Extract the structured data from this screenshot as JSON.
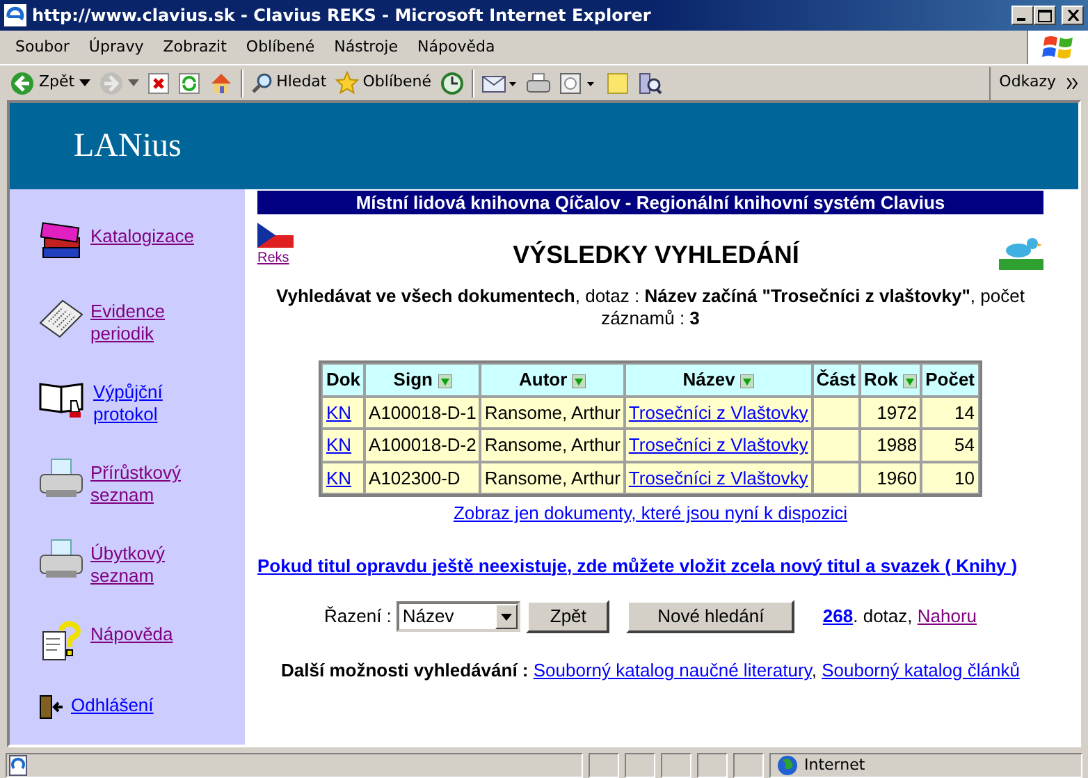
{
  "window": {
    "title": "http://www.clavius.sk - Clavius REKS - Microsoft Internet Explorer"
  },
  "menu": [
    "Soubor",
    "Úpravy",
    "Zobrazit",
    "Oblíbené",
    "Nástroje",
    "Nápověda"
  ],
  "toolbar": [
    {
      "kind": "back",
      "label": "Zpět",
      "disabled": false
    },
    {
      "kind": "forward",
      "disabled": true
    },
    {
      "kind": "stop"
    },
    {
      "kind": "refresh"
    },
    {
      "kind": "home"
    },
    {
      "kind": "search",
      "label": "Hledat"
    },
    {
      "kind": "favorites",
      "label": "Oblíbené"
    },
    {
      "kind": "history"
    },
    {
      "kind": "mail"
    },
    {
      "kind": "print"
    },
    {
      "kind": "edit"
    },
    {
      "kind": "note"
    },
    {
      "kind": "messenger"
    }
  ],
  "links_label": "Odkazy",
  "header": {
    "logo": "LANius"
  },
  "sidebar": {
    "items": [
      {
        "kind": "books",
        "label": "Katalogizace",
        "visited": true
      },
      {
        "kind": "newspaper",
        "label": "Evidence periodik",
        "visited": true
      },
      {
        "kind": "book",
        "label": "Výpůjční protokol",
        "visited": false
      },
      {
        "kind": "printer",
        "label": "Přírůstkový seznam",
        "visited": true
      },
      {
        "kind": "printer",
        "label": "Úbytkový seznam",
        "visited": true
      },
      {
        "kind": "help",
        "label": "Nápověda",
        "visited": true
      },
      {
        "kind": "logout",
        "label": "Odhlášení",
        "visited": false
      }
    ]
  },
  "banner": "Místní lidová knihovna Qíčalov - Regionální knihovní systém Clavius",
  "flag_link": {
    "label": "Reks",
    "visited": true
  },
  "heading": "VÝSLEDKY VYHLEDÁNÍ",
  "query": "**Vyhledávat ve všech dokumentech**, dotaz : **Název začíná \"Trosečníci z vlaštovky\"**, počet záznamů : **3**",
  "table": {
    "columns": [
      {
        "label": "Dok",
        "sortable": false
      },
      {
        "label": "Sign",
        "sortable": true
      },
      {
        "label": "Autor",
        "sortable": true
      },
      {
        "label": "Název",
        "sortable": true
      },
      {
        "label": "Část",
        "sortable": false
      },
      {
        "label": "Rok",
        "sortable": true
      },
      {
        "label": "Počet",
        "sortable": false
      }
    ],
    "rows": [
      [
        "KN",
        "A100018-D-1",
        "Ransome, Arthur",
        "Trosečníci z Vlaštovky",
        "",
        "1972",
        "14"
      ],
      [
        "KN",
        "A100018-D-2",
        "Ransome, Arthur",
        "Trosečníci z Vlaštovky",
        "",
        "1988",
        "54"
      ],
      [
        "KN",
        "A102300-D",
        "Ransome, Arthur",
        "Trosečníci z Vlaštovky",
        "",
        "1960",
        "10"
      ]
    ]
  },
  "available_link": "Zobraz jen dokumenty, které jsou nyní k dispozici",
  "new_title_link": "Pokud titul opravdu ještě neexistuje, zde můžete vložit zcela nový titul a svazek ( Knihy )",
  "sort": {
    "label": "Řazení :",
    "value": "Název",
    "back_button": "Zpět",
    "new_search_button": "Nové hledání",
    "query_number": "268",
    "query_text": ". dotaz,",
    "top_link": "Nahoru",
    "top_visited": true
  },
  "more": {
    "label": "Další možnosti vyhledávání :",
    "links": [
      "Souborný katalog naučné literatury",
      "Souborný katalog článků"
    ],
    "separator": ","
  },
  "status_bar": {
    "zone": "Internet"
  }
}
